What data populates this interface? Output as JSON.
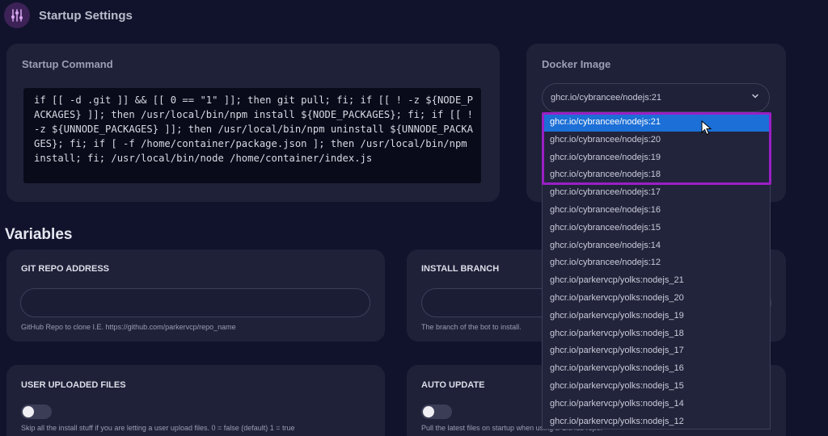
{
  "header": {
    "title": "Startup Settings",
    "icon": "sliders-icon"
  },
  "startup": {
    "title": "Startup Command",
    "command": "if [[ -d .git ]] && [[ 0 == \"1\" ]]; then git pull; fi; if [[ ! -z ${NODE_PACKAGES} ]]; then /usr/local/bin/npm install ${NODE_PACKAGES}; fi; if [[ ! -z ${UNNODE_PACKAGES} ]]; then /usr/local/bin/npm uninstall ${UNNODE_PACKAGES}; fi; if [ -f /home/container/package.json ]; then /usr/local/bin/npm install; fi; /usr/local/bin/node /home/container/index.js"
  },
  "docker": {
    "title": "Docker Image",
    "selected": "ghcr.io/cybrancee/nodejs:21",
    "options": [
      "ghcr.io/cybrancee/nodejs:21",
      "ghcr.io/cybrancee/nodejs:20",
      "ghcr.io/cybrancee/nodejs:19",
      "ghcr.io/cybrancee/nodejs:18",
      "ghcr.io/cybrancee/nodejs:17",
      "ghcr.io/cybrancee/nodejs:16",
      "ghcr.io/cybrancee/nodejs:15",
      "ghcr.io/cybrancee/nodejs:14",
      "ghcr.io/cybrancee/nodejs:12",
      "ghcr.io/parkervcp/yolks:nodejs_21",
      "ghcr.io/parkervcp/yolks:nodejs_20",
      "ghcr.io/parkervcp/yolks:nodejs_19",
      "ghcr.io/parkervcp/yolks:nodejs_18",
      "ghcr.io/parkervcp/yolks:nodejs_17",
      "ghcr.io/parkervcp/yolks:nodejs_16",
      "ghcr.io/parkervcp/yolks:nodejs_15",
      "ghcr.io/parkervcp/yolks:nodejs_14",
      "ghcr.io/parkervcp/yolks:nodejs_12"
    ]
  },
  "variables": {
    "title": "Variables",
    "git_repo": {
      "label": "GIT REPO ADDRESS",
      "value": "",
      "hint": "GitHub Repo to clone I.E. https://github.com/parkervcp/repo_name"
    },
    "install_branch": {
      "label": "INSTALL BRANCH",
      "value": "",
      "hint": "The branch of the bot to install."
    },
    "user_uploaded": {
      "label": "USER UPLOADED FILES",
      "enabled": false,
      "hint": "Skip all the install stuff if you are letting a user upload files. 0 = false (default) 1 = true"
    },
    "auto_update": {
      "label": "AUTO UPDATE",
      "enabled": false,
      "hint": "Pull the latest files on startup when using a GitHub repo."
    }
  },
  "colors": {
    "background": "#11132c",
    "card": "#1f2139",
    "accent_highlight": "#9a1fc4",
    "selected_option": "#1c6fd6"
  }
}
